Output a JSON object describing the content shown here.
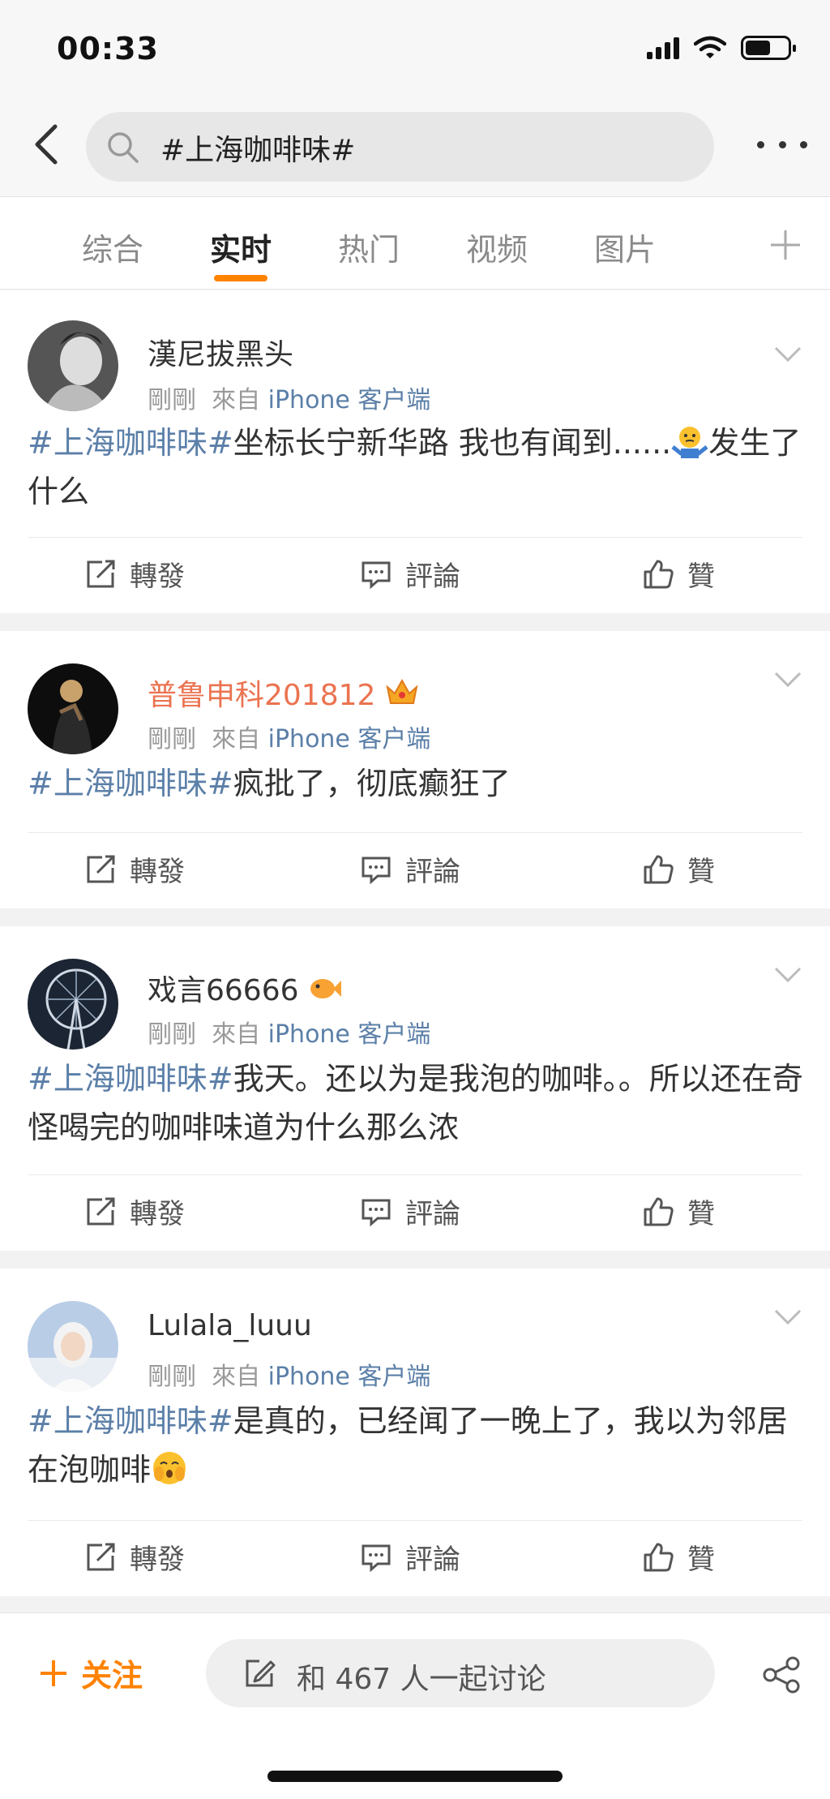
{
  "status_bar": {
    "time": "00:33"
  },
  "search": {
    "query": "#上海咖啡味#"
  },
  "tabs": [
    {
      "label": "综合",
      "active": false
    },
    {
      "label": "实时",
      "active": true
    },
    {
      "label": "热门",
      "active": false
    },
    {
      "label": "视频",
      "active": false
    },
    {
      "label": "图片",
      "active": false
    }
  ],
  "accent_color": "#ff8200",
  "link_color": "#5b7fa8",
  "posts": [
    {
      "username": "漢尼拔黑头",
      "time": "剛剛",
      "from": "來自",
      "source": "iPhone 客户端",
      "hashtag": "#上海咖啡味#",
      "text": "坐标长宁新华路 我也有闻到......",
      "text_after_emoji": "发生了什么",
      "emoji": "shrug-emoji",
      "actions": {
        "repost": "轉發",
        "comment": "評論",
        "like": "贊"
      }
    },
    {
      "username": "普鲁申科201812",
      "badge": "crown-badge",
      "time": "剛剛",
      "from": "來自",
      "source": "iPhone 客户端",
      "hashtag": "#上海咖啡味#",
      "text": "疯批了，彻底癫狂了",
      "actions": {
        "repost": "轉發",
        "comment": "評論",
        "like": "贊"
      }
    },
    {
      "username": "戏言66666",
      "badge": "fish-badge",
      "time": "剛剛",
      "from": "來自",
      "source": "iPhone 客户端",
      "hashtag": "#上海咖啡味#",
      "text": "我天。还以为是我泡的咖啡。。所以还在奇怪喝完的咖啡味道为什么那么浓",
      "actions": {
        "repost": "轉發",
        "comment": "評論",
        "like": "贊"
      }
    },
    {
      "username": "Lulala_luuu",
      "time": "剛剛",
      "from": "來自",
      "source": "iPhone 客户端",
      "hashtag": "#上海咖啡味#",
      "text": "是真的，已经闻了一晚上了，我以为邻居在泡咖啡",
      "emoji": "hushed-emoji",
      "actions": {
        "repost": "轉發",
        "comment": "評論",
        "like": "贊"
      }
    }
  ],
  "bottom_bar": {
    "follow": "关注",
    "discuss": "和 467 人一起讨论"
  }
}
